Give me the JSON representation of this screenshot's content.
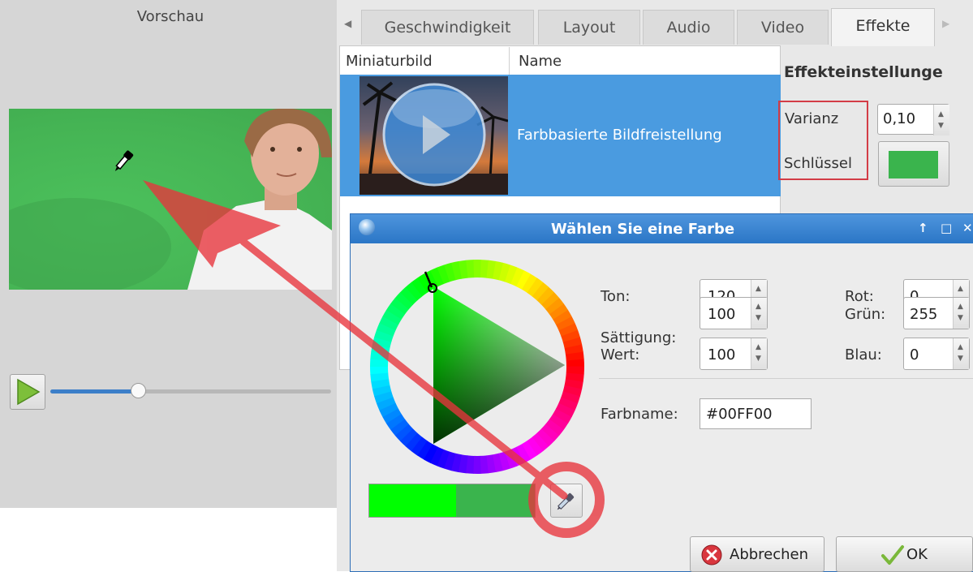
{
  "preview": {
    "title": "Vorschau"
  },
  "tabs": [
    "Geschwindigkeit",
    "Layout",
    "Audio",
    "Video",
    "Effekte"
  ],
  "effects_table": {
    "columns": [
      "Miniaturbild",
      "Name"
    ],
    "rows": [
      {
        "name": "Farbbasierte Bildfreistellung"
      }
    ]
  },
  "effect_settings": {
    "title": "Effekteinstellunge",
    "variance_label": "Varianz",
    "variance_value": "0,10",
    "key_label": "Schlüssel",
    "key_color": "#3ab44d"
  },
  "color_dialog": {
    "title": "Wählen Sie eine Farbe",
    "hsv": [
      {
        "label": "Ton:",
        "value": "120"
      },
      {
        "label": "Sättigung:",
        "value": "100"
      },
      {
        "label": "Wert:",
        "value": "100"
      }
    ],
    "rgb": [
      {
        "label": "Rot:",
        "value": "0"
      },
      {
        "label": "Grün:",
        "value": "255"
      },
      {
        "label": "Blau:",
        "value": "0"
      }
    ],
    "color_name_label": "Farbname:",
    "color_name_value": "#00FF00",
    "current_color": "#00ff00",
    "previous_color": "#3ab44d",
    "cancel_label": "Abbrechen",
    "ok_label": "OK"
  },
  "icons": {
    "play": "play-triangle-icon",
    "eyedropper": "eyedropper-icon",
    "cancel": "cancel-x-icon",
    "ok": "checkmark-icon"
  },
  "colors": {
    "accent": "#2b76c6",
    "selection": "#4a9be0",
    "highlight_red": "#d33c46"
  }
}
